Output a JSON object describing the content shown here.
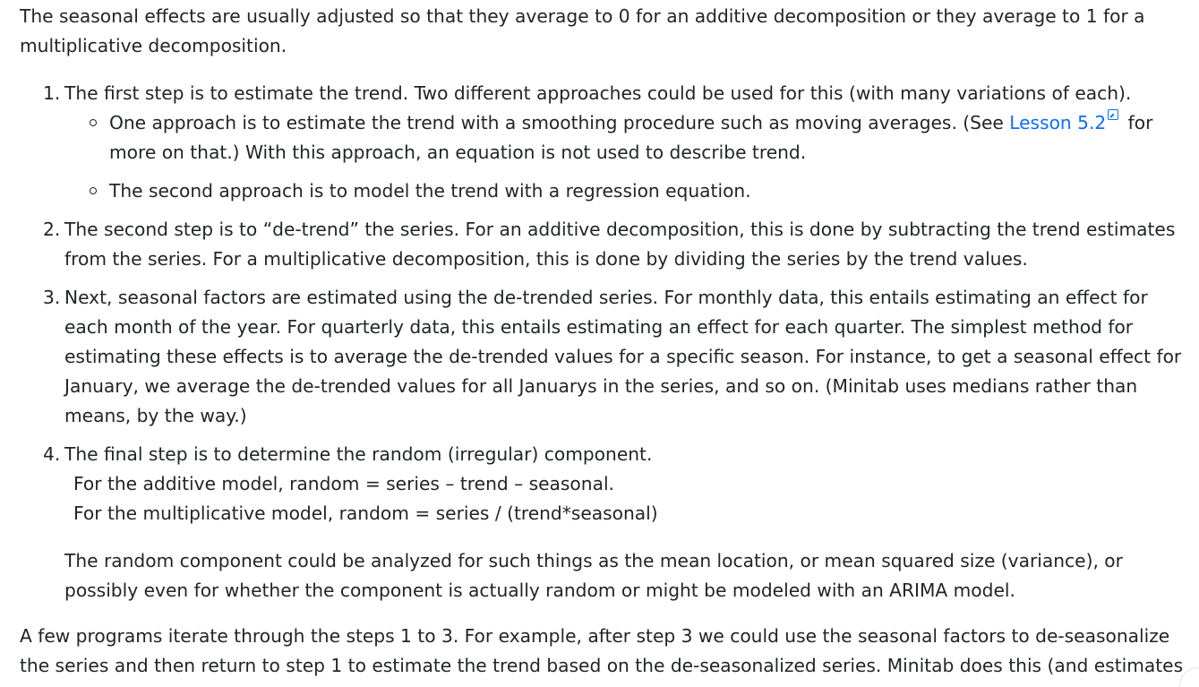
{
  "intro": "The seasonal effects are usually adjusted so that they average to 0 for an additive decomposition or they average to 1 for a multiplicative decomposition.",
  "steps": [
    {
      "number": "1.",
      "text": "The first step is to estimate the trend. Two different approaches could be used for this (with many variations of each).",
      "sub": [
        {
          "before": "One approach is to estimate the trend with a smoothing procedure such as moving averages. (See ",
          "link": "Lesson 5.2",
          "after": " for more on that.) With this approach, an equation is not used to describe trend."
        },
        {
          "text": "The second approach is to model the trend with a regression equation."
        }
      ]
    },
    {
      "number": "2.",
      "text": "The second step is to “de-trend” the series. For an additive decomposition, this is done by subtracting the trend estimates from the series. For a multiplicative decomposition, this is done by dividing the series by the trend values."
    },
    {
      "number": "3.",
      "text": "Next, seasonal factors are estimated using the de-trended series. For monthly data, this entails estimating an effect for each month of the year. For quarterly data, this entails estimating an effect for each quarter. The simplest method for estimating these effects is to average the de-trended values for a specific season. For instance, to get a seasonal effect for January, we average the de-trended values for all Januarys in the series, and so on. (Minitab uses medians rather than means, by the way.)"
    },
    {
      "number": "4.",
      "text": "The final step is to determine the random (irregular) component.",
      "formula_additive": "For the additive model, random = series – trend – seasonal.",
      "formula_multiplicative": "For the multiplicative model, random = series / (trend*seasonal)",
      "note": "The random component could be analyzed for such things as the mean location, or mean squared size (variance), or possibly even for whether the component is actually random or might be modeled with an ARIMA model."
    }
  ],
  "outro": "A few programs iterate through the steps 1 to 3. For example, after step 3 we could use the seasonal factors to de-seasonalize the series and then return to step 1 to estimate the trend based on the de-seasonalized series. Minitab does this (and estimates the trend with a straight line in the iteration.",
  "icons": {
    "external_link": "external-link-icon"
  },
  "colors": {
    "text": "#212529",
    "link": "#0d6efd"
  }
}
